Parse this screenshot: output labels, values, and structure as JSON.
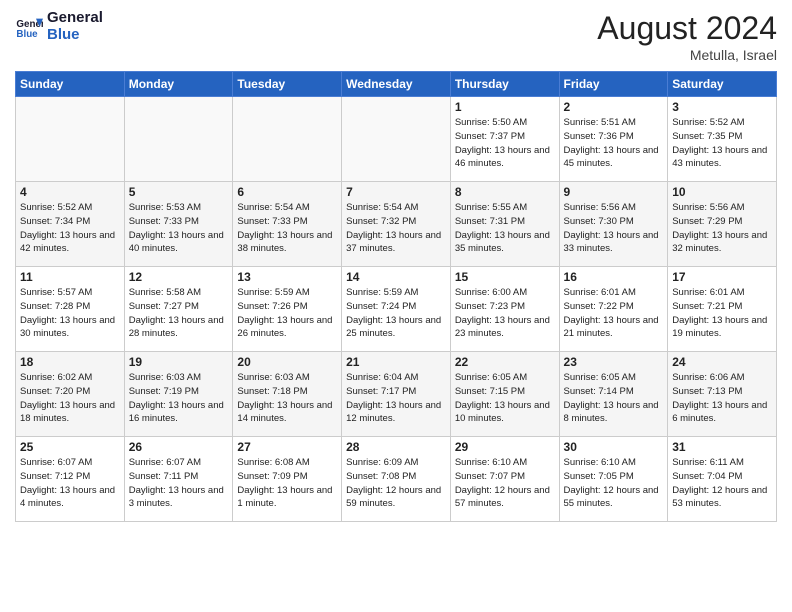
{
  "header": {
    "logo_line1": "General",
    "logo_line2": "Blue",
    "month_year": "August 2024",
    "location": "Metulla, Israel"
  },
  "weekdays": [
    "Sunday",
    "Monday",
    "Tuesday",
    "Wednesday",
    "Thursday",
    "Friday",
    "Saturday"
  ],
  "weeks": [
    [
      {
        "day": "",
        "sunrise": "",
        "sunset": "",
        "daylight": "",
        "empty": true
      },
      {
        "day": "",
        "sunrise": "",
        "sunset": "",
        "daylight": "",
        "empty": true
      },
      {
        "day": "",
        "sunrise": "",
        "sunset": "",
        "daylight": "",
        "empty": true
      },
      {
        "day": "",
        "sunrise": "",
        "sunset": "",
        "daylight": "",
        "empty": true
      },
      {
        "day": "1",
        "sunrise": "Sunrise: 5:50 AM",
        "sunset": "Sunset: 7:37 PM",
        "daylight": "Daylight: 13 hours and 46 minutes.",
        "empty": false
      },
      {
        "day": "2",
        "sunrise": "Sunrise: 5:51 AM",
        "sunset": "Sunset: 7:36 PM",
        "daylight": "Daylight: 13 hours and 45 minutes.",
        "empty": false
      },
      {
        "day": "3",
        "sunrise": "Sunrise: 5:52 AM",
        "sunset": "Sunset: 7:35 PM",
        "daylight": "Daylight: 13 hours and 43 minutes.",
        "empty": false
      }
    ],
    [
      {
        "day": "4",
        "sunrise": "Sunrise: 5:52 AM",
        "sunset": "Sunset: 7:34 PM",
        "daylight": "Daylight: 13 hours and 42 minutes.",
        "empty": false
      },
      {
        "day": "5",
        "sunrise": "Sunrise: 5:53 AM",
        "sunset": "Sunset: 7:33 PM",
        "daylight": "Daylight: 13 hours and 40 minutes.",
        "empty": false
      },
      {
        "day": "6",
        "sunrise": "Sunrise: 5:54 AM",
        "sunset": "Sunset: 7:33 PM",
        "daylight": "Daylight: 13 hours and 38 minutes.",
        "empty": false
      },
      {
        "day": "7",
        "sunrise": "Sunrise: 5:54 AM",
        "sunset": "Sunset: 7:32 PM",
        "daylight": "Daylight: 13 hours and 37 minutes.",
        "empty": false
      },
      {
        "day": "8",
        "sunrise": "Sunrise: 5:55 AM",
        "sunset": "Sunset: 7:31 PM",
        "daylight": "Daylight: 13 hours and 35 minutes.",
        "empty": false
      },
      {
        "day": "9",
        "sunrise": "Sunrise: 5:56 AM",
        "sunset": "Sunset: 7:30 PM",
        "daylight": "Daylight: 13 hours and 33 minutes.",
        "empty": false
      },
      {
        "day": "10",
        "sunrise": "Sunrise: 5:56 AM",
        "sunset": "Sunset: 7:29 PM",
        "daylight": "Daylight: 13 hours and 32 minutes.",
        "empty": false
      }
    ],
    [
      {
        "day": "11",
        "sunrise": "Sunrise: 5:57 AM",
        "sunset": "Sunset: 7:28 PM",
        "daylight": "Daylight: 13 hours and 30 minutes.",
        "empty": false
      },
      {
        "day": "12",
        "sunrise": "Sunrise: 5:58 AM",
        "sunset": "Sunset: 7:27 PM",
        "daylight": "Daylight: 13 hours and 28 minutes.",
        "empty": false
      },
      {
        "day": "13",
        "sunrise": "Sunrise: 5:59 AM",
        "sunset": "Sunset: 7:26 PM",
        "daylight": "Daylight: 13 hours and 26 minutes.",
        "empty": false
      },
      {
        "day": "14",
        "sunrise": "Sunrise: 5:59 AM",
        "sunset": "Sunset: 7:24 PM",
        "daylight": "Daylight: 13 hours and 25 minutes.",
        "empty": false
      },
      {
        "day": "15",
        "sunrise": "Sunrise: 6:00 AM",
        "sunset": "Sunset: 7:23 PM",
        "daylight": "Daylight: 13 hours and 23 minutes.",
        "empty": false
      },
      {
        "day": "16",
        "sunrise": "Sunrise: 6:01 AM",
        "sunset": "Sunset: 7:22 PM",
        "daylight": "Daylight: 13 hours and 21 minutes.",
        "empty": false
      },
      {
        "day": "17",
        "sunrise": "Sunrise: 6:01 AM",
        "sunset": "Sunset: 7:21 PM",
        "daylight": "Daylight: 13 hours and 19 minutes.",
        "empty": false
      }
    ],
    [
      {
        "day": "18",
        "sunrise": "Sunrise: 6:02 AM",
        "sunset": "Sunset: 7:20 PM",
        "daylight": "Daylight: 13 hours and 18 minutes.",
        "empty": false
      },
      {
        "day": "19",
        "sunrise": "Sunrise: 6:03 AM",
        "sunset": "Sunset: 7:19 PM",
        "daylight": "Daylight: 13 hours and 16 minutes.",
        "empty": false
      },
      {
        "day": "20",
        "sunrise": "Sunrise: 6:03 AM",
        "sunset": "Sunset: 7:18 PM",
        "daylight": "Daylight: 13 hours and 14 minutes.",
        "empty": false
      },
      {
        "day": "21",
        "sunrise": "Sunrise: 6:04 AM",
        "sunset": "Sunset: 7:17 PM",
        "daylight": "Daylight: 13 hours and 12 minutes.",
        "empty": false
      },
      {
        "day": "22",
        "sunrise": "Sunrise: 6:05 AM",
        "sunset": "Sunset: 7:15 PM",
        "daylight": "Daylight: 13 hours and 10 minutes.",
        "empty": false
      },
      {
        "day": "23",
        "sunrise": "Sunrise: 6:05 AM",
        "sunset": "Sunset: 7:14 PM",
        "daylight": "Daylight: 13 hours and 8 minutes.",
        "empty": false
      },
      {
        "day": "24",
        "sunrise": "Sunrise: 6:06 AM",
        "sunset": "Sunset: 7:13 PM",
        "daylight": "Daylight: 13 hours and 6 minutes.",
        "empty": false
      }
    ],
    [
      {
        "day": "25",
        "sunrise": "Sunrise: 6:07 AM",
        "sunset": "Sunset: 7:12 PM",
        "daylight": "Daylight: 13 hours and 4 minutes.",
        "empty": false
      },
      {
        "day": "26",
        "sunrise": "Sunrise: 6:07 AM",
        "sunset": "Sunset: 7:11 PM",
        "daylight": "Daylight: 13 hours and 3 minutes.",
        "empty": false
      },
      {
        "day": "27",
        "sunrise": "Sunrise: 6:08 AM",
        "sunset": "Sunset: 7:09 PM",
        "daylight": "Daylight: 13 hours and 1 minute.",
        "empty": false
      },
      {
        "day": "28",
        "sunrise": "Sunrise: 6:09 AM",
        "sunset": "Sunset: 7:08 PM",
        "daylight": "Daylight: 12 hours and 59 minutes.",
        "empty": false
      },
      {
        "day": "29",
        "sunrise": "Sunrise: 6:10 AM",
        "sunset": "Sunset: 7:07 PM",
        "daylight": "Daylight: 12 hours and 57 minutes.",
        "empty": false
      },
      {
        "day": "30",
        "sunrise": "Sunrise: 6:10 AM",
        "sunset": "Sunset: 7:05 PM",
        "daylight": "Daylight: 12 hours and 55 minutes.",
        "empty": false
      },
      {
        "day": "31",
        "sunrise": "Sunrise: 6:11 AM",
        "sunset": "Sunset: 7:04 PM",
        "daylight": "Daylight: 12 hours and 53 minutes.",
        "empty": false
      }
    ]
  ]
}
